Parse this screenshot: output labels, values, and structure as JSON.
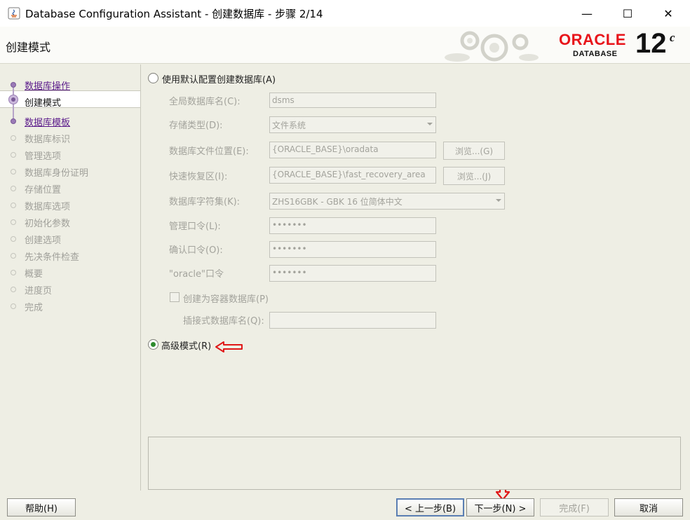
{
  "window": {
    "title": "Database Configuration Assistant - 创建数据库 - 步骤 2/14",
    "minimize": "—",
    "maximize": "☐",
    "close": "✕"
  },
  "header": {
    "title": "创建模式",
    "logo_word": "ORACLE",
    "logo_sub": "DATABASE",
    "version": "12",
    "version_sup": "c",
    "colors": {
      "oracle_red": "#e8141a"
    }
  },
  "nav": {
    "items": [
      {
        "label": "数据库操作",
        "state": "done"
      },
      {
        "label": "创建模式",
        "state": "current"
      },
      {
        "label": "数据库模板",
        "state": "done"
      },
      {
        "label": "数据库标识",
        "state": "pending"
      },
      {
        "label": "管理选项",
        "state": "pending"
      },
      {
        "label": "数据库身份证明",
        "state": "pending"
      },
      {
        "label": "存储位置",
        "state": "pending"
      },
      {
        "label": "数据库选项",
        "state": "pending"
      },
      {
        "label": "初始化参数",
        "state": "pending"
      },
      {
        "label": "创建选项",
        "state": "pending"
      },
      {
        "label": "先决条件检查",
        "state": "pending"
      },
      {
        "label": "概要",
        "state": "pending"
      },
      {
        "label": "进度页",
        "state": "pending"
      },
      {
        "label": "完成",
        "state": "pending"
      }
    ]
  },
  "form": {
    "default_radio_label": "使用默认配置创建数据库(A)",
    "global_db_name_label": "全局数据库名(C):",
    "global_db_name_value": "dsms",
    "storage_type_label": "存储类型(D):",
    "storage_type_value": "文件系统",
    "db_file_location_label": "数据库文件位置(E):",
    "db_file_location_value": "{ORACLE_BASE}\\oradata",
    "browse_g": "浏览...(G)",
    "fast_recovery_label": "快速恢复区(I):",
    "fast_recovery_value": "{ORACLE_BASE}\\fast_recovery_area",
    "browse_j": "浏览...(J)",
    "charset_label": "数据库字符集(K):",
    "charset_value": "ZHS16GBK - GBK 16 位简体中文",
    "admin_pwd_label": "管理口令(L):",
    "admin_pwd_value": "•••••••",
    "confirm_pwd_label": "确认口令(O):",
    "confirm_pwd_value": "•••••••",
    "oracle_pwd_label": "\"oracle\"口令",
    "oracle_pwd_value": "•••••••",
    "container_db_label": "创建为容器数据库(P)",
    "pdb_name_label": "插接式数据库名(Q):",
    "pdb_name_value": "",
    "advanced_radio_label": "高级模式(R)"
  },
  "buttons": {
    "help": "帮助(H)",
    "back": "< 上一步(B)",
    "next": "下一步(N) >",
    "finish": "完成(F)",
    "cancel": "取消"
  },
  "annotations": {
    "arrow_color": "#e01818"
  }
}
